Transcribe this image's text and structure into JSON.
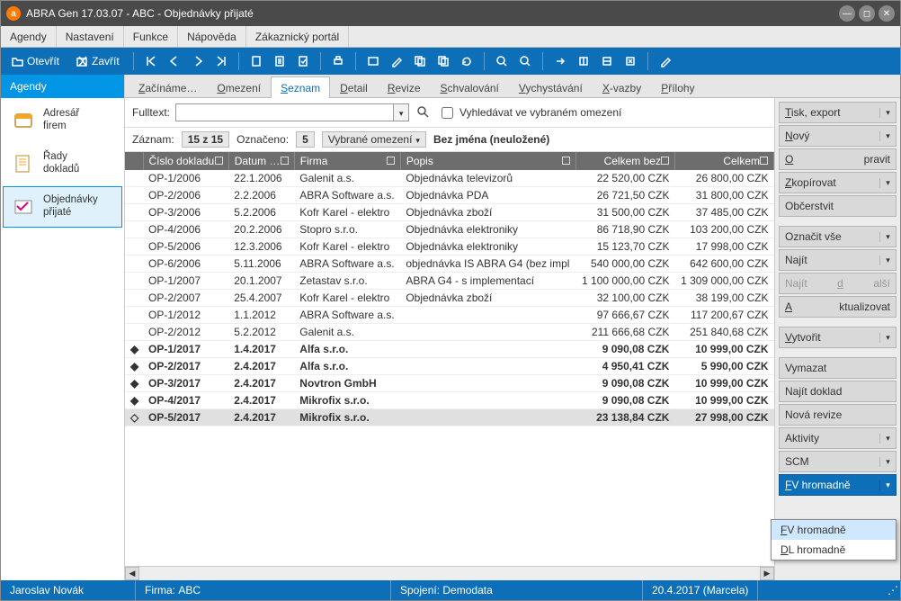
{
  "window": {
    "title": "ABRA Gen 17.03.07 - ABC - Objednávky přijaté"
  },
  "menu": {
    "items": [
      "Agendy",
      "Nastavení",
      "Funkce",
      "Nápověda",
      "Zákaznický portál"
    ]
  },
  "toolbar": {
    "open": "Otevřít",
    "close": "Zavřít"
  },
  "sidebar": {
    "header": "Agendy",
    "items": [
      {
        "label": "Adresář firem"
      },
      {
        "label": "Řady dokladů"
      },
      {
        "label": "Objednávky přijaté"
      }
    ],
    "activeIndex": 2
  },
  "tabs": {
    "items": [
      "Začínáme…",
      "Omezení",
      "Seznam",
      "Detail",
      "Revize",
      "Schvalování",
      "Vychystávání",
      "X-vazby",
      "Přílohy"
    ],
    "activeIndex": 2
  },
  "filter": {
    "fulltext_label": "Fulltext:",
    "fulltext_value": "",
    "checkbox_label": "Vyhledávat ve vybraném omezení"
  },
  "summary": {
    "record_label": "Záznam:",
    "record_value": "15 z 15",
    "marked_label": "Označeno:",
    "marked_value": "5",
    "filter_button": "Vybrané omezení",
    "filter_name": "Bez jména (neuložené)"
  },
  "grid": {
    "columns": [
      "Číslo dokladu",
      "Datum …",
      "Firma",
      "Popis",
      "Celkem bez",
      "Celkem"
    ],
    "rows": [
      {
        "mark": "",
        "c0": "OP-1/2006",
        "c1": "22.1.2006",
        "c2": "Galenit a.s.",
        "c3": "Objednávka televizorů",
        "c4": "22 520,00 CZK",
        "c5": "26 800,00 CZK",
        "bold": false
      },
      {
        "mark": "",
        "c0": "OP-2/2006",
        "c1": "2.2.2006",
        "c2": "ABRA Software a.s.",
        "c3": "Objednávka PDA",
        "c4": "26 721,50 CZK",
        "c5": "31 800,00 CZK",
        "bold": false
      },
      {
        "mark": "",
        "c0": "OP-3/2006",
        "c1": "5.2.2006",
        "c2": "Kofr Karel - elektro",
        "c3": "Objednávka zboží",
        "c4": "31 500,00 CZK",
        "c5": "37 485,00 CZK",
        "bold": false
      },
      {
        "mark": "",
        "c0": "OP-4/2006",
        "c1": "20.2.2006",
        "c2": "Stopro s.r.o.",
        "c3": "Objednávka elektroniky",
        "c4": "86 718,90 CZK",
        "c5": "103 200,00 CZK",
        "bold": false
      },
      {
        "mark": "",
        "c0": "OP-5/2006",
        "c1": "12.3.2006",
        "c2": "Kofr Karel - elektro",
        "c3": "Objednávka elektroniky",
        "c4": "15 123,70 CZK",
        "c5": "17 998,00 CZK",
        "bold": false
      },
      {
        "mark": "",
        "c0": "OP-6/2006",
        "c1": "5.11.2006",
        "c2": "ABRA Software a.s.",
        "c3": "objednávka IS ABRA G4 (bez impl",
        "c4": "540 000,00 CZK",
        "c5": "642 600,00 CZK",
        "bold": false
      },
      {
        "mark": "",
        "c0": "OP-1/2007",
        "c1": "20.1.2007",
        "c2": "Zetastav s.r.o.",
        "c3": "ABRA G4 - s implementací",
        "c4": "1 100 000,00 CZK",
        "c5": "1 309 000,00 CZK",
        "bold": false
      },
      {
        "mark": "",
        "c0": "OP-2/2007",
        "c1": "25.4.2007",
        "c2": "Kofr Karel - elektro",
        "c3": "Objednávka zboží",
        "c4": "32 100,00 CZK",
        "c5": "38 199,00 CZK",
        "bold": false
      },
      {
        "mark": "",
        "c0": "OP-1/2012",
        "c1": "1.1.2012",
        "c2": "ABRA Software a.s.",
        "c3": "",
        "c4": "97 666,67 CZK",
        "c5": "117 200,67 CZK",
        "bold": false
      },
      {
        "mark": "",
        "c0": "OP-2/2012",
        "c1": "5.2.2012",
        "c2": "Galenit a.s.",
        "c3": "",
        "c4": "211 666,68 CZK",
        "c5": "251 840,68 CZK",
        "bold": false
      },
      {
        "mark": "◆",
        "c0": "OP-1/2017",
        "c1": "1.4.2017",
        "c2": "Alfa s.r.o.",
        "c3": "",
        "c4": "9 090,08 CZK",
        "c5": "10 999,00 CZK",
        "bold": true
      },
      {
        "mark": "◆",
        "c0": "OP-2/2017",
        "c1": "2.4.2017",
        "c2": "Alfa s.r.o.",
        "c3": "",
        "c4": "4 950,41 CZK",
        "c5": "5 990,00 CZK",
        "bold": true
      },
      {
        "mark": "◆",
        "c0": "OP-3/2017",
        "c1": "2.4.2017",
        "c2": "Novtron GmbH",
        "c3": "",
        "c4": "9 090,08 CZK",
        "c5": "10 999,00 CZK",
        "bold": true
      },
      {
        "mark": "◆",
        "c0": "OP-4/2017",
        "c1": "2.4.2017",
        "c2": "Mikrofix s.r.o.",
        "c3": "",
        "c4": "9 090,08 CZK",
        "c5": "10 999,00 CZK",
        "bold": true
      },
      {
        "mark": "◇",
        "c0": "OP-5/2017",
        "c1": "2.4.2017",
        "c2": "Mikrofix s.r.o.",
        "c3": "",
        "c4": "23 138,84 CZK",
        "c5": "27 998,00 CZK",
        "bold": true,
        "sel": true
      }
    ]
  },
  "rightbar": {
    "buttons": [
      {
        "label": "Tisk, export",
        "split": true,
        "key": "T"
      },
      {
        "label": "Nový",
        "split": true,
        "key": "N"
      },
      {
        "label": "Opravit",
        "split": false,
        "key": "O"
      },
      {
        "label": "Zkopírovat",
        "split": true,
        "key": "Z"
      },
      {
        "label": "Občerstvit",
        "split": false,
        "gapAfter": true
      },
      {
        "label": "Označit vše",
        "split": true
      },
      {
        "label": "Najít",
        "split": true,
        "key": "j"
      },
      {
        "label": "Najít další",
        "split": false,
        "disabled": true,
        "key": "d"
      },
      {
        "label": "Aktualizovat",
        "split": false,
        "gapAfter": true,
        "key": "A"
      },
      {
        "label": "Vytvořit",
        "split": true,
        "key": "V",
        "gapAfter": true
      },
      {
        "label": "Vymazat",
        "split": false
      },
      {
        "label": "Najít doklad",
        "split": false
      },
      {
        "label": "Nová revize",
        "split": false
      },
      {
        "label": "Aktivity",
        "split": true
      },
      {
        "label": "SCM",
        "split": true
      },
      {
        "label": "FV hromadně",
        "split": true,
        "selected": true,
        "key": "F"
      }
    ],
    "popup": {
      "items": [
        {
          "label": "FV hromadně",
          "key": "F",
          "hover": true
        },
        {
          "label": "DL hromadně",
          "key": "D"
        }
      ]
    }
  },
  "status": {
    "user": "Jaroslav Novák",
    "firm_label": "Firma:",
    "firm_value": "ABC",
    "conn_label": "Spojení:",
    "conn_value": "Demodata",
    "date": "20.4.2017 (Marcela)"
  }
}
